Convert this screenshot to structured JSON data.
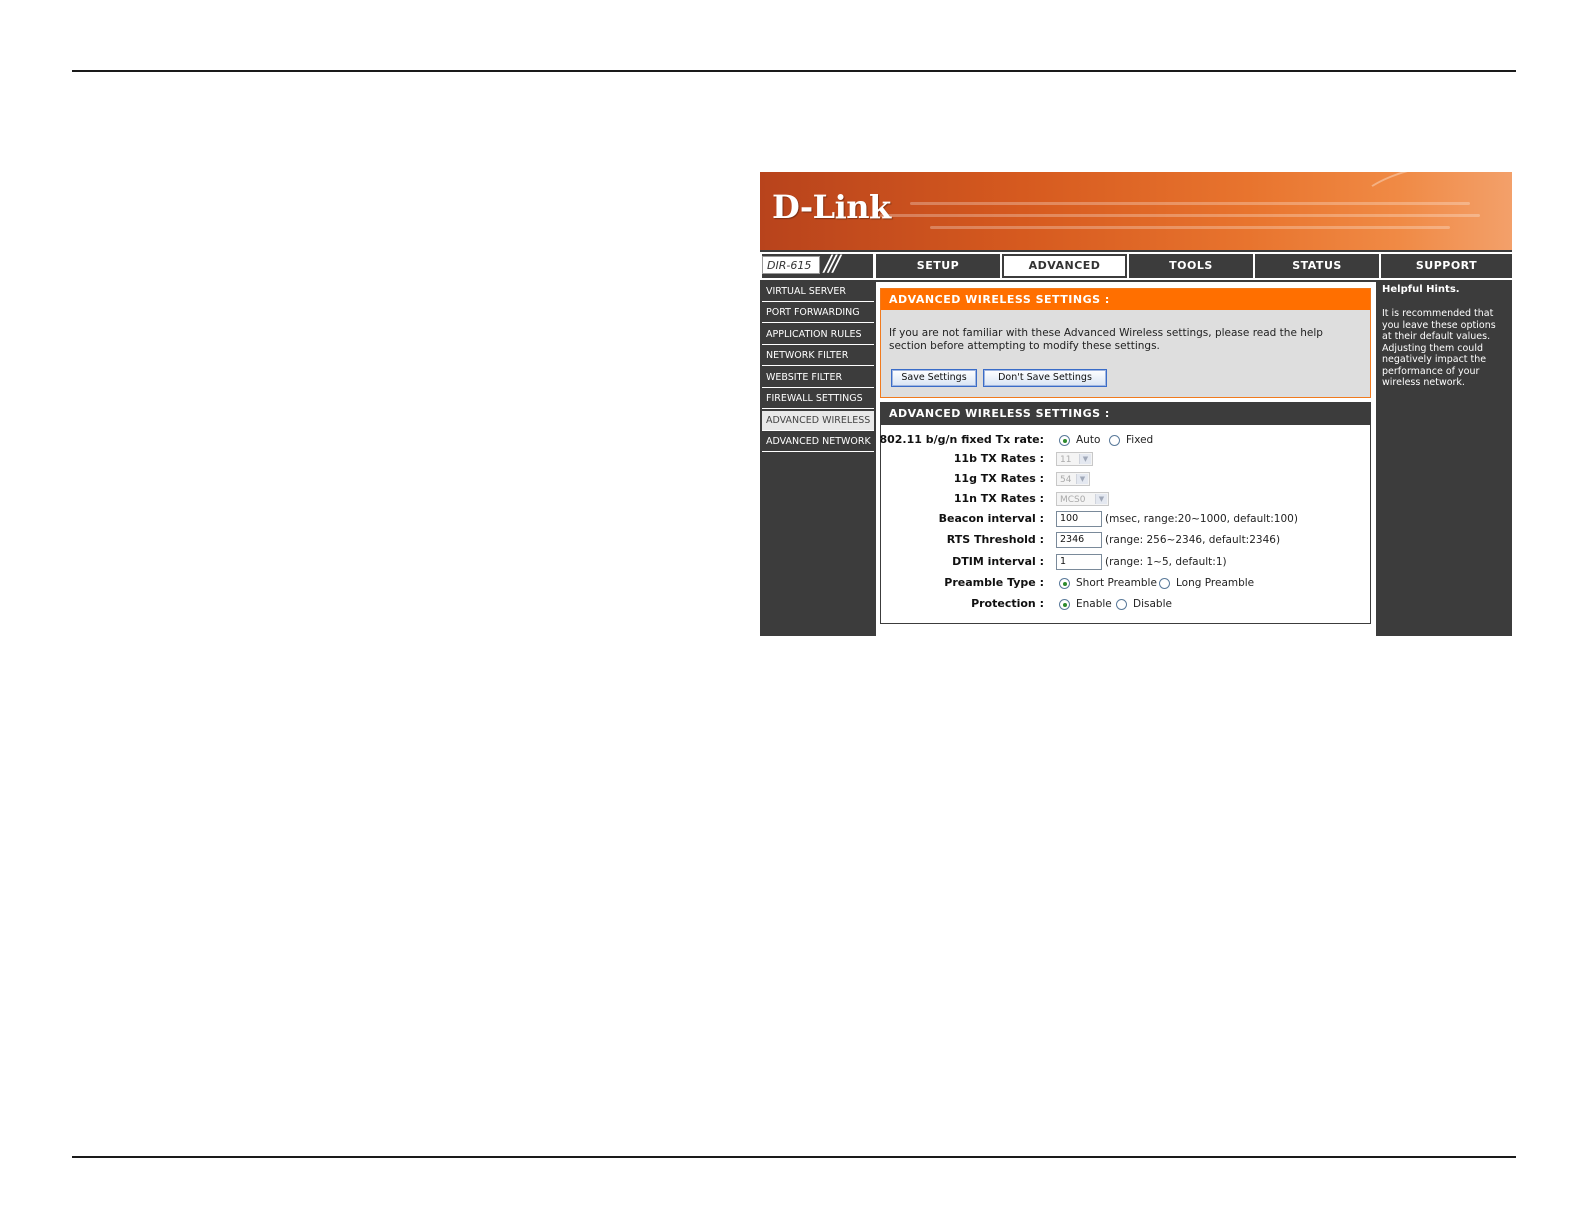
{
  "router": {
    "logo": "D-Link",
    "model": "DIR-615",
    "tabs": [
      {
        "label": "SETUP",
        "active": false
      },
      {
        "label": "ADVANCED",
        "active": true
      },
      {
        "label": "TOOLS",
        "active": false
      },
      {
        "label": "STATUS",
        "active": false
      },
      {
        "label": "SUPPORT",
        "active": false
      }
    ],
    "sidebar": [
      {
        "label": "VIRTUAL SERVER",
        "active": false
      },
      {
        "label": "PORT FORWARDING",
        "active": false
      },
      {
        "label": "APPLICATION RULES",
        "active": false
      },
      {
        "label": "NETWORK FILTER",
        "active": false
      },
      {
        "label": "WEBSITE FILTER",
        "active": false
      },
      {
        "label": "FIREWALL SETTINGS",
        "active": false
      },
      {
        "label": "ADVANCED WIRELESS",
        "active": true
      },
      {
        "label": "ADVANCED NETWORK",
        "active": false
      }
    ],
    "intro": {
      "header": "ADVANCED WIRELESS SETTINGS :",
      "message": "If you are not familiar with these Advanced Wireless settings, please read the help section before attempting to modify these settings.",
      "save_label": "Save Settings",
      "dont_save_label": "Don't Save Settings"
    },
    "settings": {
      "header": "ADVANCED WIRELESS SETTINGS :",
      "tx_rate": {
        "label": "802.11 b/g/n fixed Tx rate:",
        "option_auto": "Auto",
        "option_fixed": "Fixed",
        "selected": "Auto"
      },
      "rate_11b": {
        "label": "11b TX Rates :",
        "value": "11"
      },
      "rate_11g": {
        "label": "11g TX Rates :",
        "value": "54"
      },
      "rate_11n": {
        "label": "11n TX Rates :",
        "value": "MCS0"
      },
      "beacon": {
        "label": "Beacon interval :",
        "value": "100",
        "hint": "(msec, range:20~1000, default:100)"
      },
      "rts": {
        "label": "RTS Threshold :",
        "value": "2346",
        "hint": "(range: 256~2346, default:2346)"
      },
      "dtim": {
        "label": "DTIM interval :",
        "value": "1",
        "hint": "(range: 1~5, default:1)"
      },
      "preamble": {
        "label": "Preamble Type :",
        "option_short": "Short Preamble",
        "option_long": "Long Preamble",
        "selected": "Short Preamble"
      },
      "protection": {
        "label": "Protection :",
        "option_enable": "Enable",
        "option_disable": "Disable",
        "selected": "Enable"
      }
    },
    "help": {
      "title": "Helpful Hints.",
      "text": "It is recommended that you leave these options at their default values. Adjusting them could negatively impact the performance of your wireless network."
    },
    "icons": {
      "select_arrow": "chevron-down-icon",
      "radio": "radio-icon"
    },
    "colors": {
      "accent": "#ff6f00",
      "panel": "#3c3c3c"
    }
  }
}
